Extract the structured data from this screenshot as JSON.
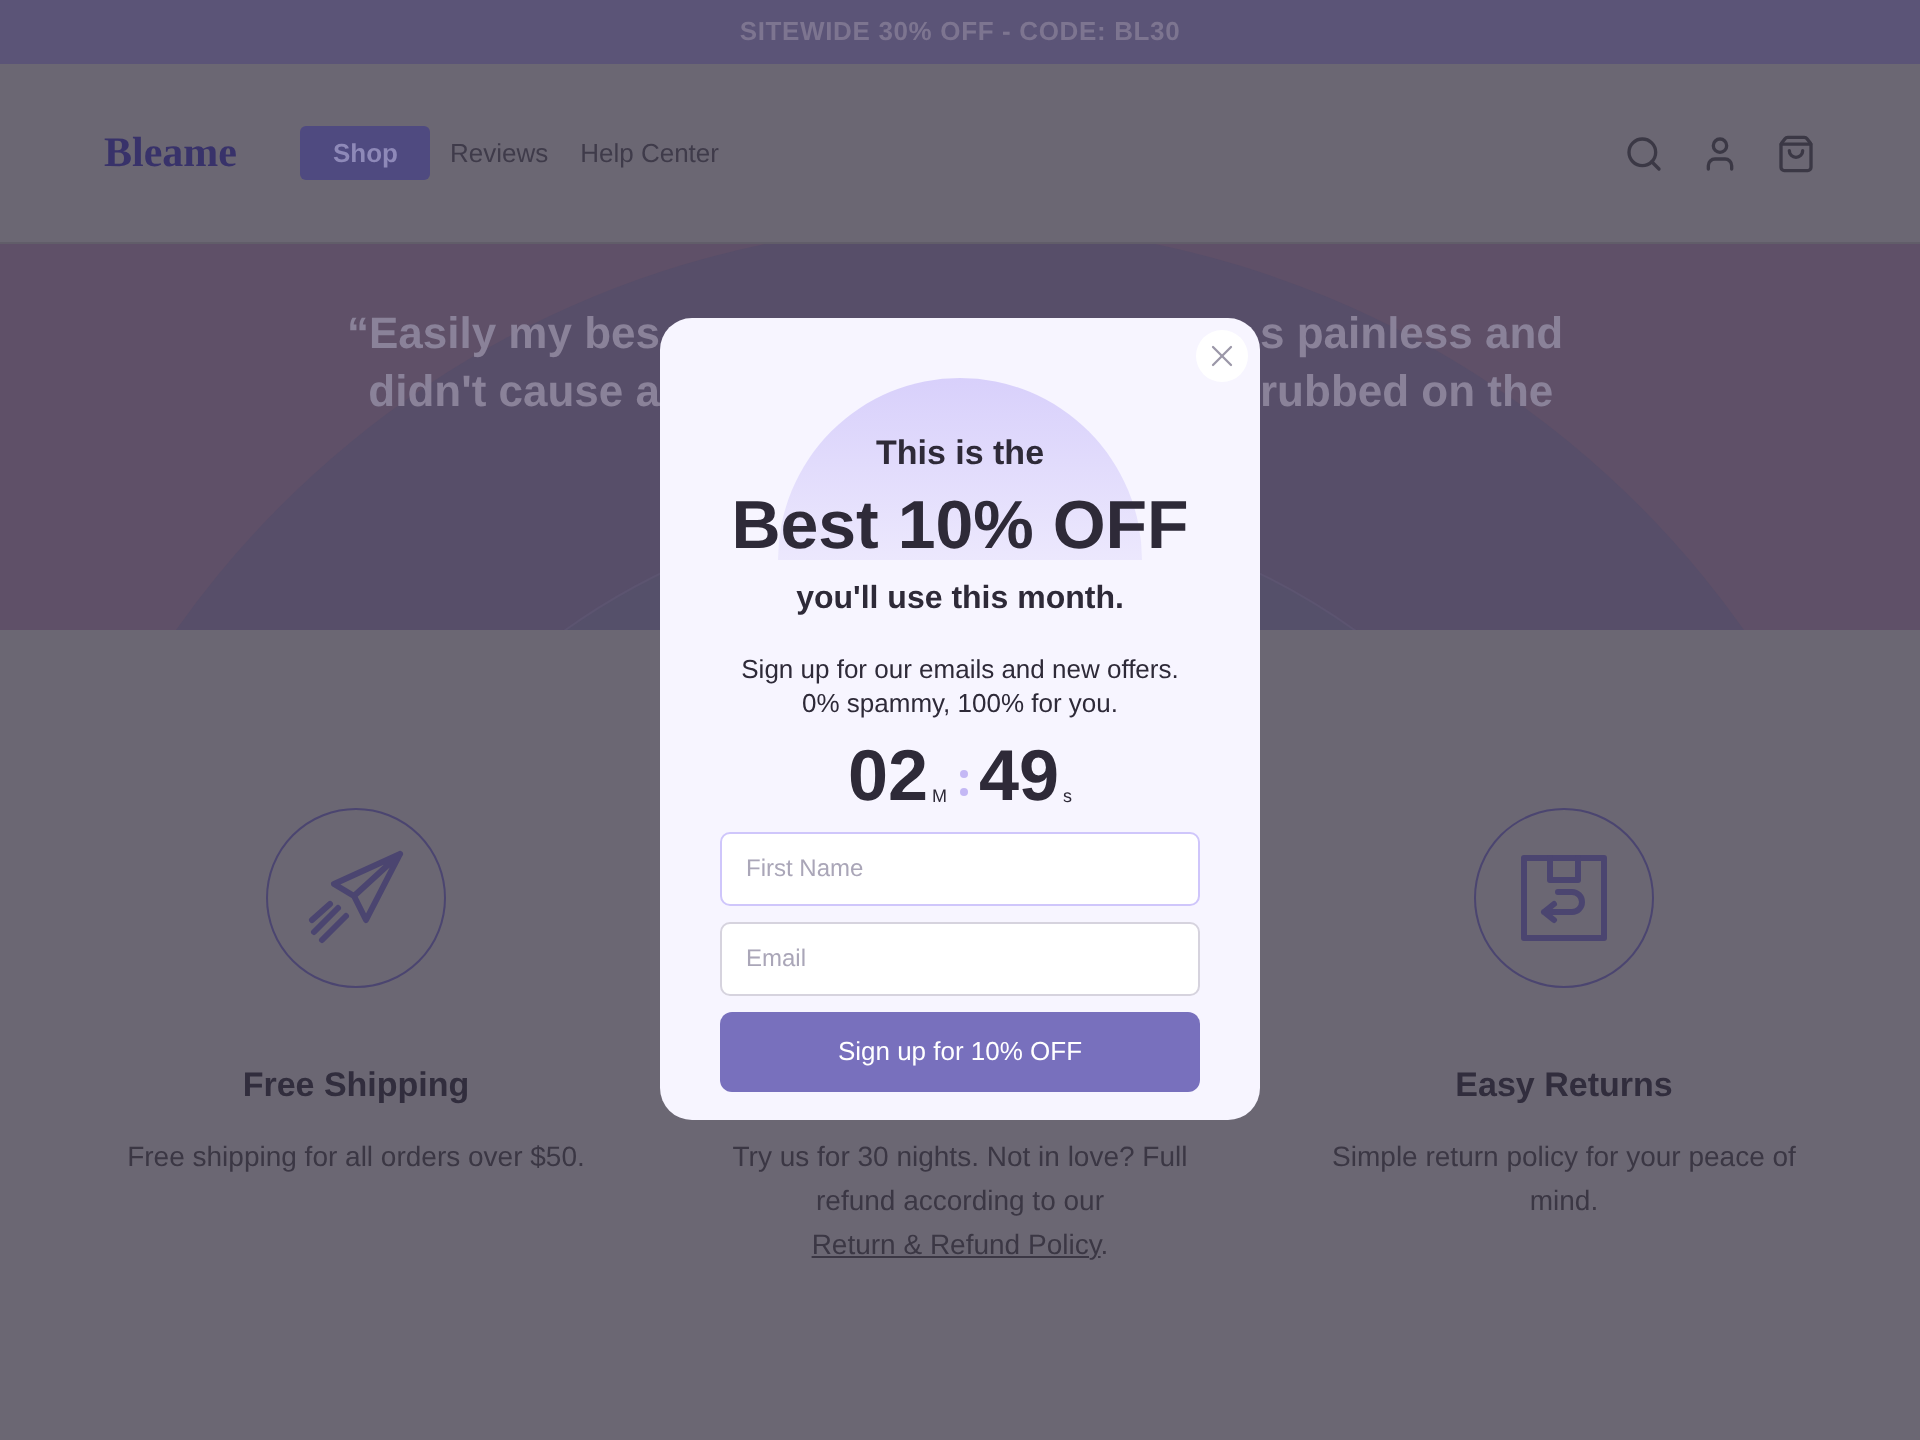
{
  "announcement": "SITEWIDE 30% OFF - CODE: BL30",
  "header": {
    "logo": "Bleame",
    "nav": [
      {
        "label": "Shop",
        "selected": true
      },
      {
        "label": "Reviews",
        "selected": false
      },
      {
        "label": "Help Center",
        "selected": false
      }
    ]
  },
  "hero": {
    "quote_lines": [
      {
        "left": "“Easily my bes",
        "right": "s painless and"
      },
      {
        "left": "didn't cause a",
        "right": "rubbed on the"
      }
    ]
  },
  "features": [
    {
      "kind": "shipping",
      "title": "Free Shipping",
      "text": "Free shipping for all orders over $50."
    },
    {
      "kind": "trial",
      "text": "Try us for 30 nights. Not in love? Full refund according to our ",
      "link": "Return & Refund Policy",
      "after": "."
    },
    {
      "kind": "returns",
      "title": "Easy Returns",
      "text": "Simple return policy for your peace of mind."
    }
  ],
  "popup": {
    "eyebrow": "This is the",
    "headline": "Best 10% OFF",
    "subline": "you'll use this month.",
    "body": "Sign up for our emails and new offers. 0% spammy, 100% for you.",
    "timer": {
      "minutes": "02",
      "minutes_unit": "M",
      "seconds": "49",
      "seconds_unit": "s"
    },
    "fields": [
      {
        "placeholder": "First Name"
      },
      {
        "placeholder": "Email"
      }
    ],
    "button": "Sign up for 10% OFF"
  }
}
